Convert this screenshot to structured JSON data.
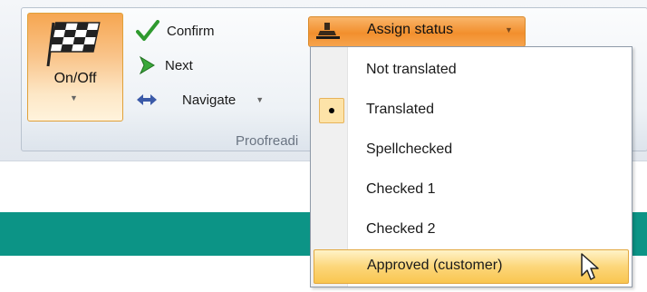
{
  "ribbon": {
    "group_label": "Proofreadi",
    "on_off": {
      "label": "On/Off"
    },
    "confirm": {
      "label": "Confirm",
      "icon": "checkmark-icon"
    },
    "next": {
      "label": "Next",
      "icon": "next-arrow-icon"
    },
    "navigate": {
      "label": "Navigate",
      "icon": "navigate-arrows-icon"
    },
    "assign_status": {
      "label": "Assign status",
      "icon": "stamp-icon"
    }
  },
  "menu": {
    "items": [
      {
        "label": "Not translated"
      },
      {
        "label": "Translated",
        "checked": true
      },
      {
        "label": "Spellchecked"
      },
      {
        "label": "Checked 1"
      },
      {
        "label": "Checked 2"
      },
      {
        "label": "Approved (customer)",
        "highlighted": true
      }
    ]
  },
  "colors": {
    "accent_orange": "#f28f2d",
    "highlight_yellow": "#fcd67a",
    "teal_bar": "#0c9486"
  }
}
